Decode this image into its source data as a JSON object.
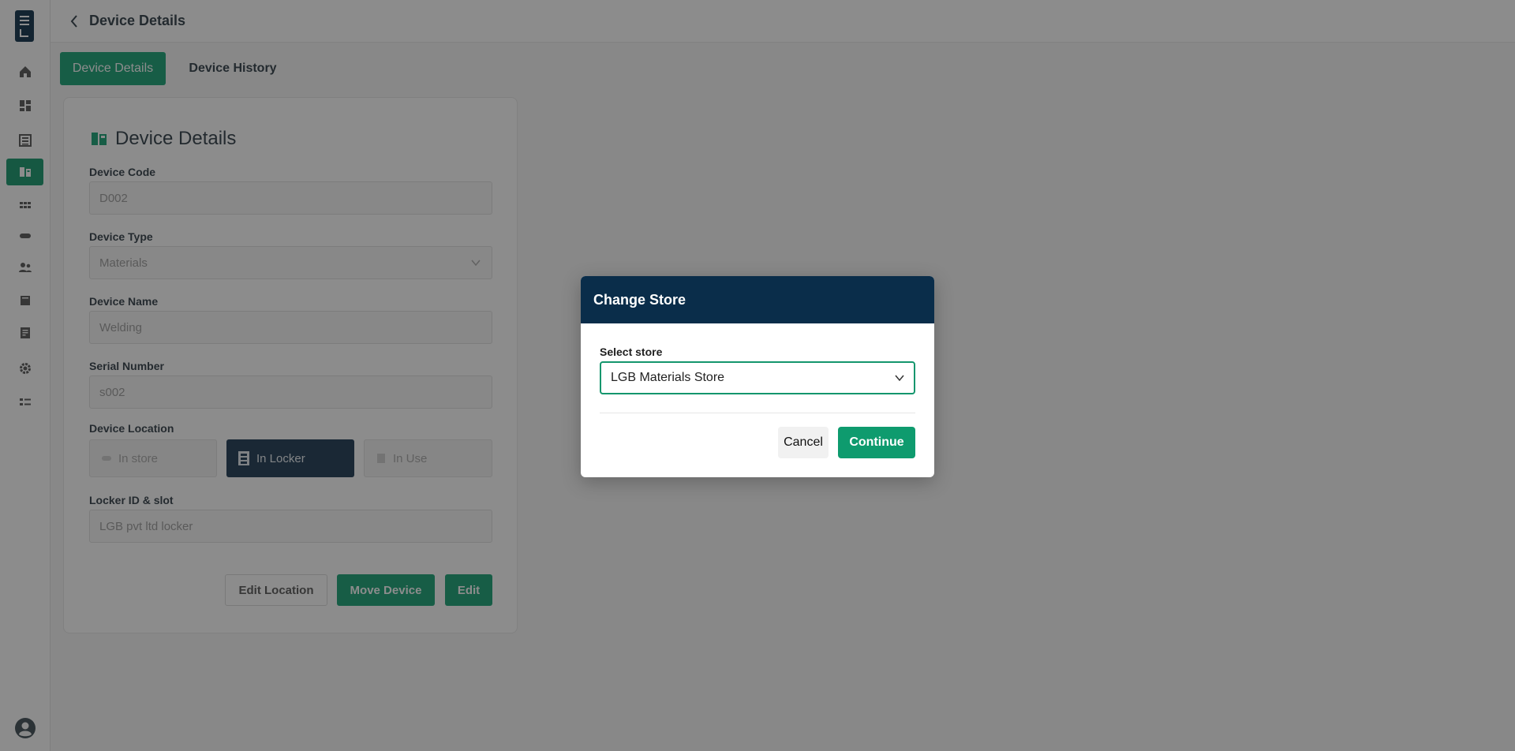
{
  "header": {
    "title": "Device Details"
  },
  "tabs": [
    {
      "label": "Device Details",
      "active": true
    },
    {
      "label": "Device History",
      "active": false
    }
  ],
  "card": {
    "title": "Device Details",
    "fields": {
      "device_code": {
        "label": "Device Code",
        "value": "D002"
      },
      "device_type": {
        "label": "Device Type",
        "value": "Materials"
      },
      "device_name": {
        "label": "Device Name",
        "value": "Welding"
      },
      "serial_number": {
        "label": "Serial Number",
        "value": "s002"
      },
      "device_location": {
        "label": "Device Location",
        "options": [
          {
            "label": "In store",
            "selected": false
          },
          {
            "label": "In Locker",
            "selected": true
          },
          {
            "label": "In Use",
            "selected": false
          }
        ]
      },
      "locker_slot": {
        "label": "Locker ID & slot",
        "value": "LGB pvt ltd locker"
      }
    },
    "buttons": {
      "edit_location": "Edit Location",
      "move_device": "Move Device",
      "edit": "Edit"
    }
  },
  "modal": {
    "title": "Change Store",
    "select_label": "Select store",
    "selected_store": "LGB Materials Store",
    "cancel_label": "Cancel",
    "continue_label": "Continue"
  },
  "sidebar": {
    "items": [
      {
        "icon": "home-icon",
        "active": false
      },
      {
        "icon": "dashboard-icon",
        "active": false
      },
      {
        "icon": "inventory-icon",
        "active": false
      },
      {
        "icon": "devices-icon",
        "active": true
      },
      {
        "icon": "grid-icon",
        "active": false
      },
      {
        "icon": "tag-icon",
        "active": false
      },
      {
        "icon": "users-icon",
        "active": false
      },
      {
        "icon": "store-icon",
        "active": false
      },
      {
        "icon": "report-icon",
        "active": false
      },
      {
        "icon": "settings-icon",
        "active": false
      },
      {
        "icon": "list-icon",
        "active": false
      }
    ]
  },
  "colors": {
    "brand_green": "#14a073",
    "modal_header": "#0a2d4a",
    "selected_location": "#1b3650"
  }
}
